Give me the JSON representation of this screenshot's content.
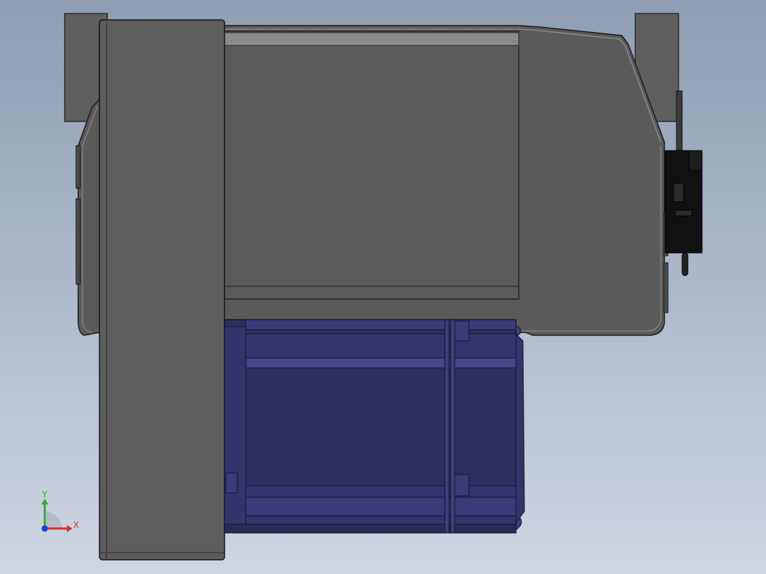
{
  "viewport": {
    "background_top": "#8e9db3",
    "background_bottom": "#cfd6e2"
  },
  "model": {
    "housing_color": "#5e5e5e",
    "housing_dark": "#2a2a2a",
    "motor_color": "#2e2f60",
    "motor_highlight": "#46478a",
    "bracket_color": "#111111"
  },
  "triad": {
    "x_label": "X",
    "y_label": "Y",
    "x_color": "#d83030",
    "y_color": "#2fb030",
    "z_color": "#2040d0"
  }
}
